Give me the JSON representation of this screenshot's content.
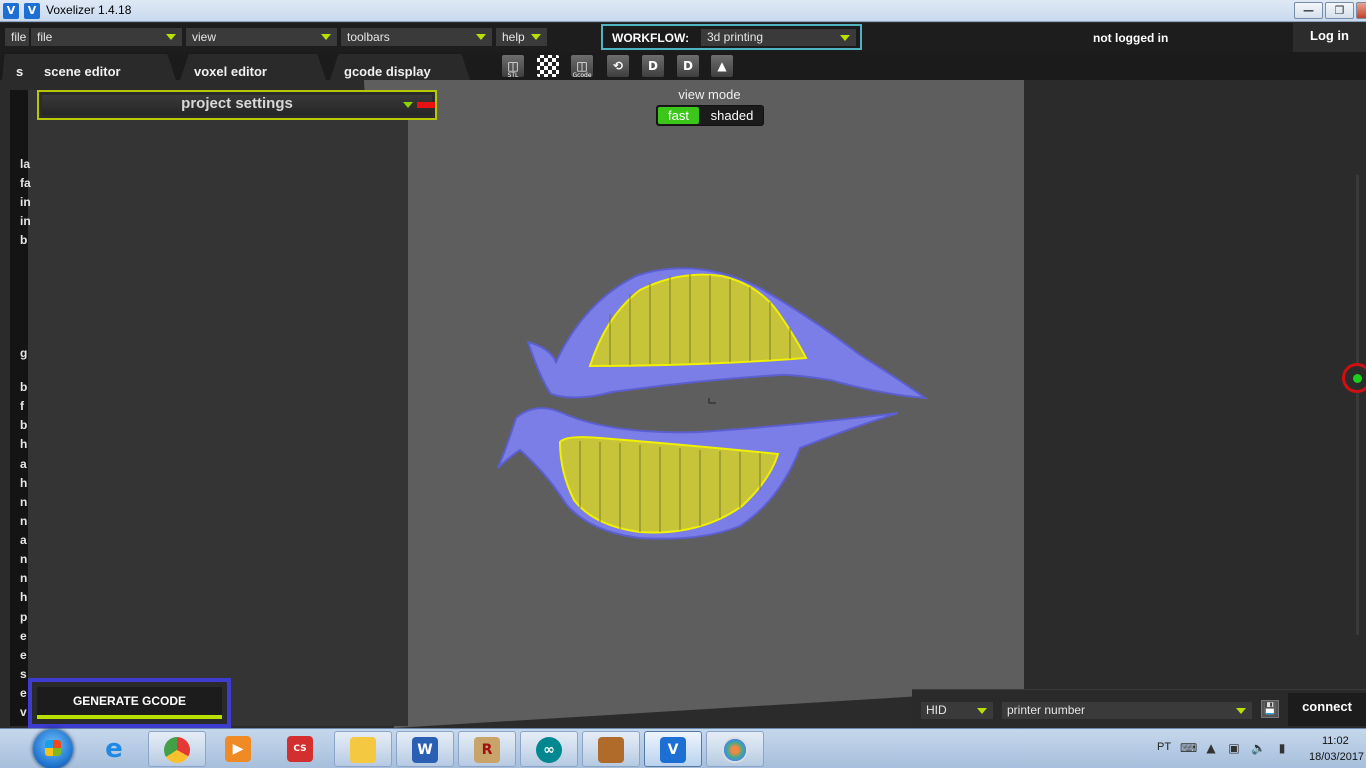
{
  "window": {
    "title": "Voxelizer 1.4.18"
  },
  "menubar": {
    "file_short": "file",
    "file": "file",
    "view": "view",
    "toolbars": "toolbars",
    "help": "help",
    "workflow_label": "WORKFLOW:",
    "workflow_value": "3d printing",
    "login_status": "not logged in",
    "login_button": "Log in"
  },
  "tabs": {
    "cut_tab": "s",
    "scene_editor": "scene editor",
    "voxel_editor": "voxel editor",
    "gcode_display": "gcode display"
  },
  "toolbar_icons": {
    "open_stl_caption": "STL",
    "open_gcode_caption": "Gcode",
    "icon_names": [
      "open-stl-icon",
      "checker-icon",
      "open-gcode-icon",
      "rotate-icon",
      "view-d-icon",
      "view-d2-icon",
      "slice-icon"
    ]
  },
  "sidebar": {
    "project_settings": "project settings",
    "cutoff_letters_top": [
      "la",
      "fa",
      "in",
      "in",
      "b"
    ],
    "cutoff_letter_group": "g",
    "cutoff_letters_bottom": [
      "b",
      "f",
      "b",
      "h",
      "a",
      "h",
      "n",
      "n",
      "a",
      "n",
      "n",
      "h",
      "p",
      "e",
      "e",
      "s",
      "e",
      "v"
    ]
  },
  "view_mode": {
    "label": "view mode",
    "fast": "fast",
    "shaded": "shaded",
    "selected": "fast"
  },
  "generate_gcode": "GENERATE GCODE",
  "printer": {
    "connection_type": "HID",
    "printer_number": "printer number",
    "connect": "connect"
  },
  "colors": {
    "model_fill": "#7b7ee6",
    "infill_outline": "#f0f000",
    "accent_green": "#3bc61a",
    "accent_lime": "#b8e000",
    "generate_border": "#3c3ccf",
    "workflow_border": "#4fb3c4"
  },
  "taskbar": {
    "language": "PT",
    "time": "11:02",
    "date": "18/03/2017",
    "apps": [
      "internet-explorer-icon",
      "chrome-icon",
      "media-player-icon",
      "eagle-icon",
      "file-explorer-icon",
      "word-icon",
      "rhino-icon",
      "arduino-icon",
      "copper-cam-icon",
      "voxelizer-icon",
      "paint-icon"
    ]
  }
}
